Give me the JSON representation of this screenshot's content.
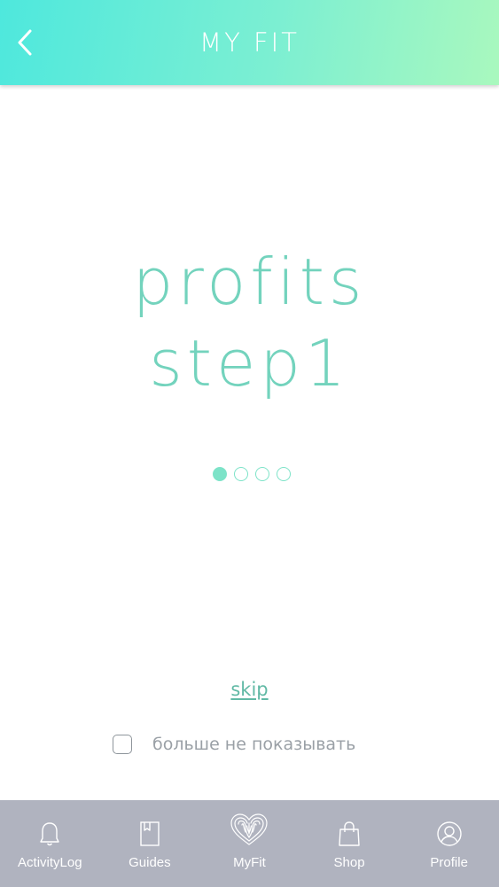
{
  "header": {
    "title": "MY FIT",
    "back_icon": "chevron-left-icon"
  },
  "slide": {
    "line1": "profits",
    "line2": "step1",
    "page_count": 4,
    "active_page": 1
  },
  "skip_label": "skip",
  "dont_show_again": {
    "label": "больше не показывать",
    "checked": false
  },
  "bottom_nav": {
    "items": [
      {
        "label": "ActivityLog",
        "icon": "bell-icon"
      },
      {
        "label": "Guides",
        "icon": "book-icon"
      },
      {
        "label": "MyFit",
        "icon": "fingerprint-heart-icon"
      },
      {
        "label": "Shop",
        "icon": "shopping-bag-icon"
      },
      {
        "label": "Profile",
        "icon": "user-circle-icon"
      }
    ]
  },
  "colors": {
    "header_gradient_start": "#4ee8dd",
    "header_gradient_end": "#a9f8be",
    "accent_text": "#73d3bd",
    "dot": "#7de3c8",
    "skip_link": "#61b9a5",
    "nav_background": "#b0b3bf"
  }
}
